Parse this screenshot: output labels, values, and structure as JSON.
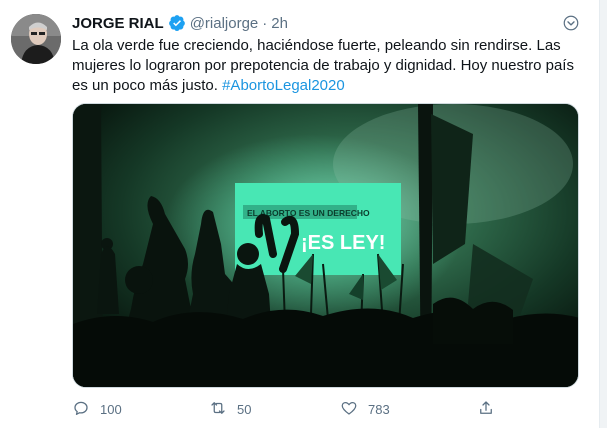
{
  "tweet": {
    "author_name": "JORGE RIAL",
    "handle": "@rialjorge",
    "separator": "·",
    "time": "2h",
    "text_lines": [
      "La ola verde fue creciendo, haciéndose fuerte, peleando sin rendirse. Las",
      "mujeres lo lograron por prepotencia de trabajo y dignidad. Hoy nuestro país",
      "es un poco más justo. "
    ],
    "hashtag": "#AbortoLegal2020",
    "media": {
      "screen_text_top": "EL ABORTO ES UN DERECHO",
      "screen_text_main": "¡ES LEY!"
    },
    "actions": {
      "reply_count": "100",
      "retweet_count": "50",
      "like_count": "783"
    }
  },
  "icons": {
    "verified": "verified-badge-icon",
    "more": "more-options-icon",
    "reply": "reply-icon",
    "retweet": "retweet-icon",
    "like": "heart-icon",
    "share": "share-icon"
  },
  "colors": {
    "link": "#1b95e0",
    "muted": "#5b7083",
    "verified": "#1da1f2",
    "screen": "#27e0a6"
  }
}
